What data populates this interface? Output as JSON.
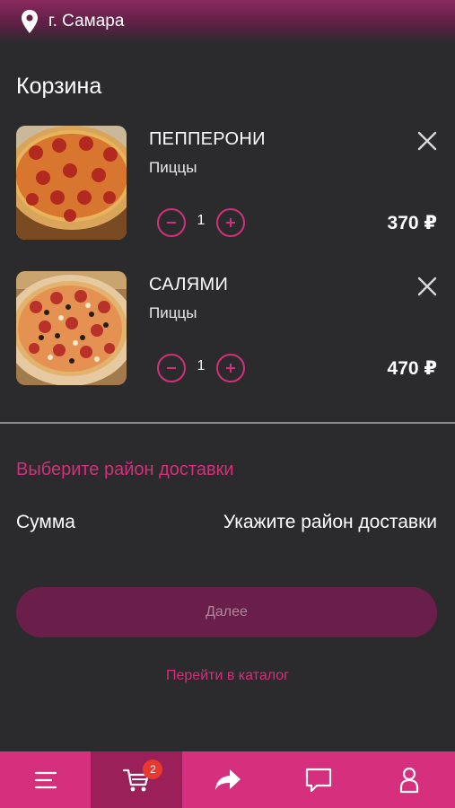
{
  "header": {
    "city": "г. Самара",
    "icon": "location-pin-icon"
  },
  "page_title": "Корзина",
  "cart": {
    "items": [
      {
        "name": "ПЕППЕРОНИ",
        "category": "Пиццы",
        "quantity": "1",
        "price": "370 ₽",
        "image": "pepperoni-pizza"
      },
      {
        "name": "САЛЯМИ",
        "category": "Пиццы",
        "quantity": "1",
        "price": "470 ₽",
        "image": "salami-pizza"
      }
    ]
  },
  "delivery": {
    "select_district": "Выберите район доставки"
  },
  "summary": {
    "label": "Сумма",
    "value": "Укажите район доставки"
  },
  "actions": {
    "next": "Далее",
    "catalog": "Перейти в каталог"
  },
  "tabbar": {
    "cart_badge": "2",
    "tabs": [
      "menu-icon",
      "cart-icon",
      "share-icon",
      "chat-icon",
      "profile-icon"
    ]
  },
  "colors": {
    "accent": "#d62f7d",
    "accent_dark": "#9b2059",
    "background": "#2b2b2d",
    "button": "#6a1f4b"
  }
}
